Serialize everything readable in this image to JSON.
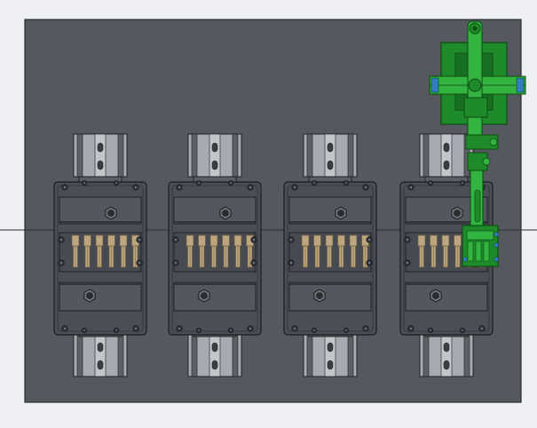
{
  "viewport": {
    "background": "#eef0f4",
    "plate_color": "#55585f",
    "plate_edge": "#2a2c30",
    "center_line": "#2c2e33"
  },
  "assembly": {
    "module_count": 4,
    "fingers_per_module": 6,
    "rail_color": "#a6abb1",
    "rail_dark": "#5d6167",
    "frame_color": "#4b4e55",
    "frame_line": "#1a1c1f",
    "finger_color": "#bba67f",
    "finger_dark": "#6d5b3b",
    "robot_arm_color": "#1f8a2a",
    "robot_arm_light": "#33b33f",
    "robot_arm_dark": "#0c4d13",
    "accent_blue": "#2f7ec0"
  }
}
